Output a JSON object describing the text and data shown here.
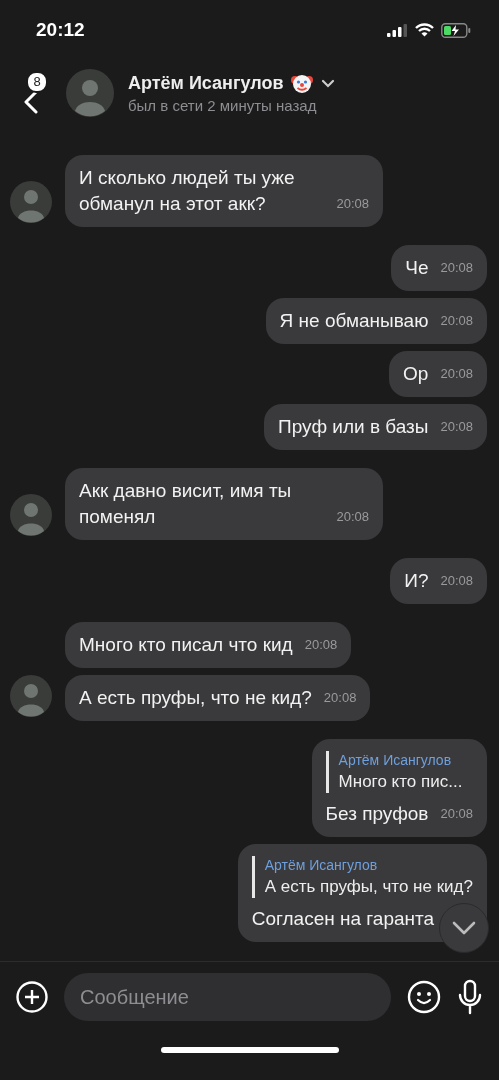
{
  "status_bar": {
    "time": "20:12"
  },
  "header": {
    "unread_count": "8",
    "name": "Артём Исангулов",
    "status": "был в сети 2 минуты назад"
  },
  "messages": [
    {
      "kind": "in",
      "avatar": true,
      "text": "И сколько людей ты уже обманул на этот акк?",
      "time": "20:08"
    },
    {
      "kind": "out",
      "text": "Че",
      "time": "20:08"
    },
    {
      "kind": "out",
      "text": "Я не обманываю",
      "time": "20:08"
    },
    {
      "kind": "out",
      "text": "Ор",
      "time": "20:08"
    },
    {
      "kind": "out",
      "text": "Пруф или в базы",
      "time": "20:08"
    },
    {
      "kind": "in",
      "avatar": true,
      "text": "Акк давно висит, имя ты поменял",
      "time": "20:08"
    },
    {
      "kind": "out",
      "text": "И?",
      "time": "20:08"
    },
    {
      "kind": "in",
      "avatar": false,
      "text": "Много кто писал что кид",
      "time": "20:08"
    },
    {
      "kind": "in",
      "avatar": true,
      "text": "А есть пруфы, что не кид?",
      "time": "20:08"
    },
    {
      "kind": "out",
      "reply": {
        "author": "Артём Исангулов",
        "text": "Много кто пис..."
      },
      "text": "Без пруфов",
      "time": "20:08"
    },
    {
      "kind": "out",
      "reply": {
        "author": "Артём Исангулов",
        "text": "А есть пруфы, что не кид?"
      },
      "text": "Согласен на гаранта"
    }
  ],
  "composer": {
    "placeholder": "Сообщение"
  }
}
